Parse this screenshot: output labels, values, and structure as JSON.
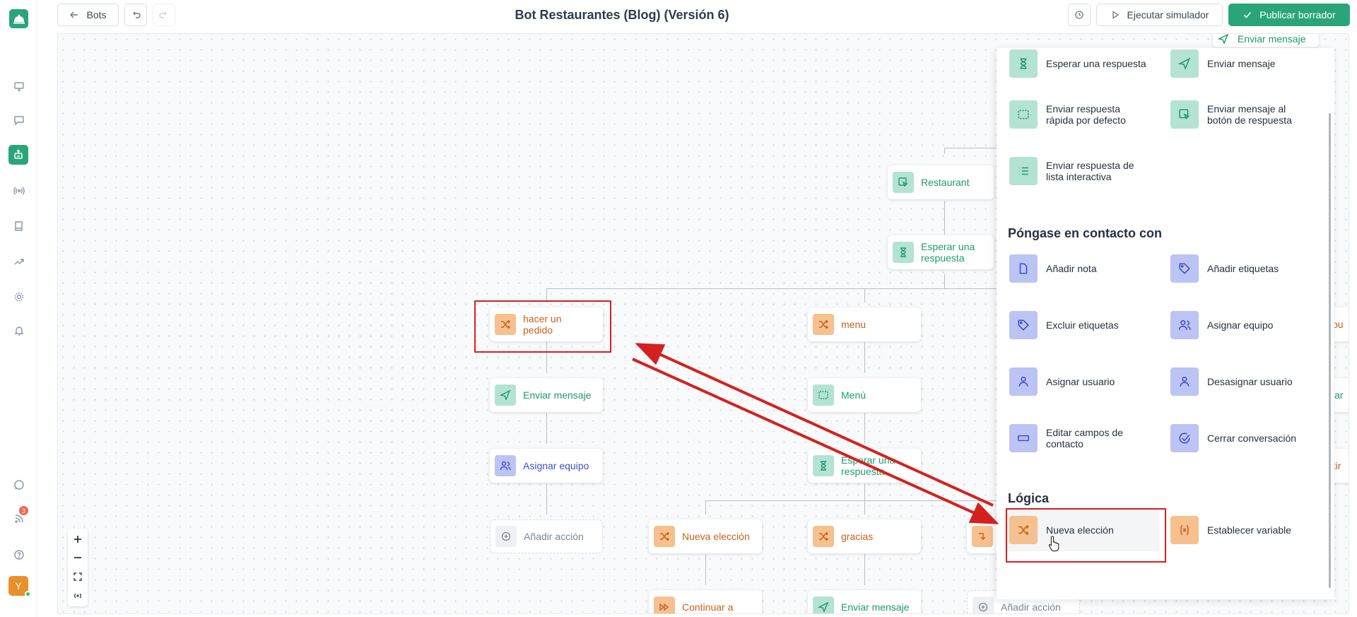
{
  "topbar": {
    "back_label": "Bots",
    "title": "Bot Restaurantes (Blog) (Versión 6)",
    "simulate_label": "Ejecutar simulador",
    "publish_label": "Publicar borrador"
  },
  "sidebar": {
    "notification_count": "3",
    "avatar_initial": "Y"
  },
  "canvas": {
    "nodes": {
      "restaurant": "Restaurant",
      "wait_1": "Esperar una respuesta",
      "hacer": "hacer un pedido",
      "menu": "menu",
      "enviar_1": "Enviar mensaje",
      "menu_cap": "Menú",
      "asignar": "Asignar equipo",
      "wait_2": "Esperar una respuesta",
      "add_action_1": "Añadir acción",
      "nueva": "Nueva elección",
      "gracias": "gracias",
      "continuar": "Continuar a",
      "enviar_2": "Enviar mensaje",
      "add_action_2": "Añadir acción",
      "enviar_top": "Enviar mensaje",
      "clip_right_1": "spu",
      "clip_right_2": "viar",
      "clip_right_3": "ntir"
    }
  },
  "panel": {
    "items_top": [
      {
        "label": "Esperar una respuesta",
        "icon": "hourglass-icon"
      },
      {
        "label": "Enviar mensaje",
        "icon": "send-icon"
      },
      {
        "label": "Enviar respuesta rápida por defecto",
        "icon": "quick-reply-icon"
      },
      {
        "label": "Enviar mensaje al botón de respuesta",
        "icon": "reply-button-icon"
      },
      {
        "label": "Enviar respuesta de lista interactiva",
        "icon": "list-icon"
      }
    ],
    "contact_title": "Póngase en contacto con",
    "contact_items": [
      {
        "label": "Añadir nota",
        "icon": "note-icon"
      },
      {
        "label": "Añadir etiquetas",
        "icon": "tag-icon"
      },
      {
        "label": "Excluir etiquetas",
        "icon": "tag-icon"
      },
      {
        "label": "Asignar equipo",
        "icon": "team-icon"
      },
      {
        "label": "Asignar usuario",
        "icon": "user-icon"
      },
      {
        "label": "Desasignar usuario",
        "icon": "user-icon"
      },
      {
        "label": "Editar campos de contacto",
        "icon": "fields-icon"
      },
      {
        "label": "Cerrar conversación",
        "icon": "check-circle-icon"
      }
    ],
    "logic_title": "Lógica",
    "logic_items": [
      {
        "label": "Nueva elección",
        "icon": "shuffle-icon"
      },
      {
        "label": "Establecer variable",
        "icon": "variable-icon"
      }
    ]
  },
  "colors": {
    "brand": "#2aa57a",
    "orange": "#f6c08f",
    "teal": "#b4e2d3",
    "blue": "#bcc4f4",
    "annotation": "#d52020"
  }
}
